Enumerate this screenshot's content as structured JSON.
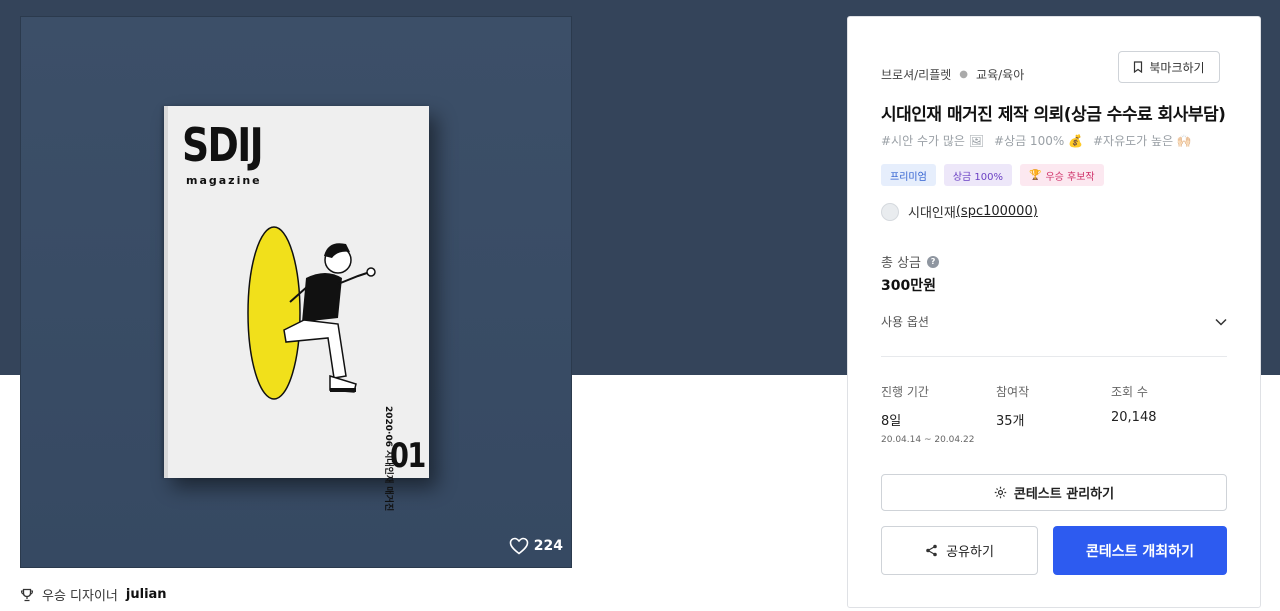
{
  "image": {
    "magazine_title": "SDIJ",
    "magazine_sub": "magazine",
    "magazine_date": "2020·06 시대인재 매거진",
    "magazine_issue": "01",
    "likes": "224"
  },
  "winner": {
    "prefix": "우승 디자이너",
    "name": "julian"
  },
  "panel": {
    "category": "브로셔/리플렛",
    "subcategory": "교육/육아",
    "bookmark_label": "북마크하기",
    "title": "시대인재 매거진 제작 의뢰(상금 수수료 회사부담)",
    "tags": [
      "#시안 수가 많은 🖼",
      "#상금 100% 💰",
      "#자유도가 높은 🙌🏻"
    ],
    "badges": {
      "premium": "프리미엄",
      "prize": "상금 100%",
      "candidate": "우승 후보작"
    },
    "host_name": "시대인재",
    "host_id": "(spc100000)",
    "prize_label": "총 상금",
    "prize_value": "300만원",
    "usage_label": "사용 옵션",
    "stats": {
      "period_label": "진행 기간",
      "period_value": "8일",
      "period_range": "20.04.14 ~ 20.04.22",
      "entries_label": "참여작",
      "entries_value": "35개",
      "views_label": "조회 수",
      "views_value": "20,148"
    },
    "manage_label": "콘테스트 관리하기",
    "share_label": "공유하기",
    "host_button_label": "콘테스트 개최하기"
  },
  "colors": {
    "banner": "#34445a",
    "primary": "#2d5bf0",
    "illustration_yellow": "#f1e01b"
  }
}
